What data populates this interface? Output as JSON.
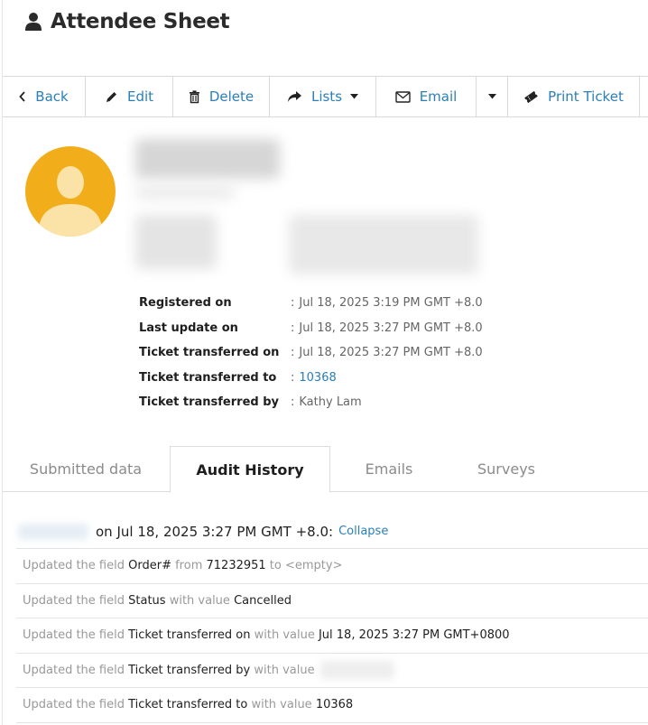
{
  "header": {
    "title": "Attendee Sheet",
    "icon": "user-icon"
  },
  "toolbar": {
    "back": "Back",
    "edit": "Edit",
    "delete": "Delete",
    "lists": "Lists",
    "email": "Email",
    "print": "Print Ticket"
  },
  "details": [
    {
      "label": "Registered on",
      "sep": ":",
      "value": "Jul 18, 2025 3:19 PM GMT +8.0"
    },
    {
      "label": "Last update on",
      "sep": ":",
      "value": "Jul 18, 2025 3:27 PM GMT +8.0"
    },
    {
      "label": "Ticket transferred on",
      "sep": ":",
      "value": "Jul 18, 2025 3:27 PM GMT +8.0"
    },
    {
      "label": "Ticket transferred to",
      "sep": ":",
      "value": "10368"
    },
    {
      "label": "Ticket transferred by",
      "sep": ":",
      "value": "Kathy Lam"
    }
  ],
  "tabs": [
    "Submitted data",
    "Audit History",
    "Emails",
    "Surveys"
  ],
  "active_tab": "Audit History",
  "history": {
    "header_text": "on Jul 18, 2025 3:27 PM GMT +8.0:",
    "collapse": "Collapse",
    "rows": [
      {
        "p1": "Updated the field ",
        "field": "Order#",
        "p2": " from ",
        "v1": "71232951",
        "p3": " to ",
        "v2": "<empty>"
      },
      {
        "p1": "Updated the field ",
        "field": "Status",
        "p2": " with value ",
        "v1": "Cancelled"
      },
      {
        "p1": "Updated the field ",
        "field": "Ticket transferred on",
        "p2": " with value ",
        "v1": "Jul 18, 2025 3:27 PM GMT+0800"
      },
      {
        "p1": "Updated the field ",
        "field": "Ticket transferred by",
        "p2": " with value"
      },
      {
        "p1": "Updated the field ",
        "field": "Ticket transferred to",
        "p2": " with value ",
        "v1": "10368"
      }
    ]
  },
  "colors": {
    "accent": "#2a7fb8",
    "avatar_bg": "#f2ad1a",
    "avatar_figure": "#fbe3a8"
  }
}
